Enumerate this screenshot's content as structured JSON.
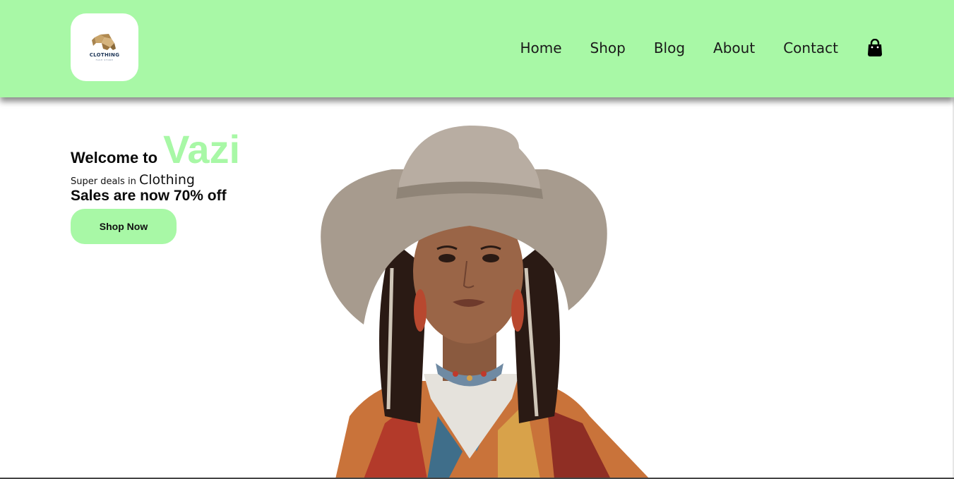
{
  "header": {
    "logo": {
      "title": "CLOTHING",
      "subtitle": "FASH STORE",
      "icon": "elephant-logo-icon"
    },
    "nav": [
      "Home",
      "Shop",
      "Blog",
      "About",
      "Contact"
    ],
    "cart_icon": "shopping-bag-icon"
  },
  "hero": {
    "welcome": "Welcome to",
    "brand": "Vazi",
    "deals_prefix": "Super deals in",
    "deals_category": "Clothing",
    "sale_text": "Sales are now 70% off",
    "cta_label": "Shop Now",
    "image": "model-in-wide-brim-hat"
  },
  "colors": {
    "accent": "#a8f8a6",
    "text": "#111111",
    "background": "#ffffff"
  }
}
